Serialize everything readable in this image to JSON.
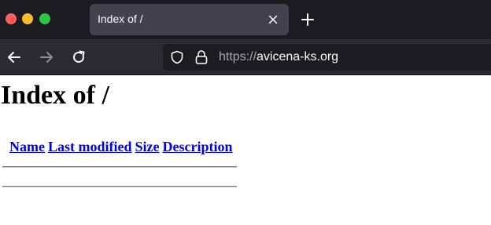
{
  "browser": {
    "tab": {
      "title": "Index of /"
    },
    "url": {
      "scheme": "https://",
      "host": "avicena-ks.org"
    },
    "icons": {
      "close": "close-icon",
      "new_tab": "plus-icon",
      "back": "arrow-left-icon",
      "forward": "arrow-right-icon",
      "reload": "reload-icon",
      "tracking": "shield-icon",
      "security": "lock-icon"
    },
    "colors": {
      "tabstrip": "#1c1b22",
      "tab_active": "#42414d",
      "toolbar": "#2b2a33",
      "close_dot": "#ff5f57",
      "minimize_dot": "#febc2e",
      "zoom_dot": "#28c840"
    }
  },
  "page": {
    "title": "Index of /",
    "columns": [
      "Name",
      "Last modified",
      "Size",
      "Description"
    ],
    "link_color": "#0000ee"
  }
}
